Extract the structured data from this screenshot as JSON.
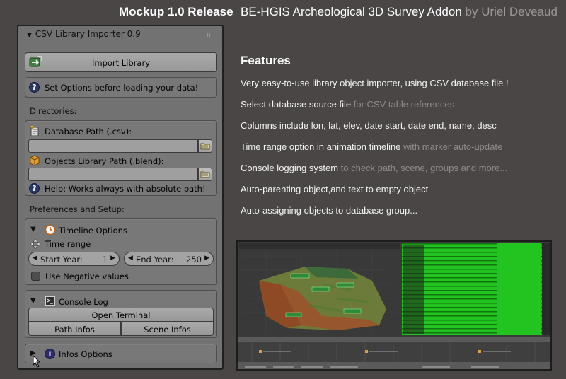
{
  "header": {
    "release": "Mockup 1.0 Release",
    "title": "BE-HGIS Archeological 3D Survey Addon",
    "author": "by Uriel Deveaud"
  },
  "features": {
    "heading": "Features",
    "items": [
      {
        "text": "Very easy-to-use library object importer, using CSV database file !",
        "note": ""
      },
      {
        "text": "Select database source file",
        "note": " for CSV table references"
      },
      {
        "text": "Columns include lon, lat, elev, date start, date end, name, desc",
        "note": ""
      },
      {
        "text": "Time range option in animation timeline",
        "note": " with marker auto-update"
      },
      {
        "text": "Console logging system",
        "note": " to check path, scene, groups and more..."
      },
      {
        "text": "Auto-parenting object,and text to empty object",
        "note": ""
      },
      {
        "text": "Auto-assigning objects to database group...",
        "note": ""
      }
    ]
  },
  "panel": {
    "title": "CSV Library Importer 0.9",
    "import_button": "Import Library",
    "set_options_hint": "Set Options before loading your data!",
    "directories_label": "Directories:",
    "database_path_label": "Database Path (.csv):",
    "database_path_value": "",
    "objects_path_label": "Objects Library Path (.blend):",
    "objects_path_value": "",
    "help_text": "Help: Works always with absolute path!",
    "prefs_label": "Preferences and Setup:",
    "timeline_label": "Timeline Options",
    "time_range_label": "Time range",
    "start_year_label": "Start Year:",
    "start_year_value": "1",
    "end_year_label": "End Year:",
    "end_year_value": "250",
    "negative_label": "Use Negative values",
    "negative_checked": false,
    "console_label": "Console Log",
    "open_terminal": "Open Terminal",
    "path_infos": "Path Infos",
    "scene_infos": "Scene Infos",
    "infos_label": "Infos Options"
  },
  "colors": {
    "background": "#4a4645",
    "panel": "#727272",
    "console_green": "#22c41f",
    "author_grey": "#9a9694"
  }
}
